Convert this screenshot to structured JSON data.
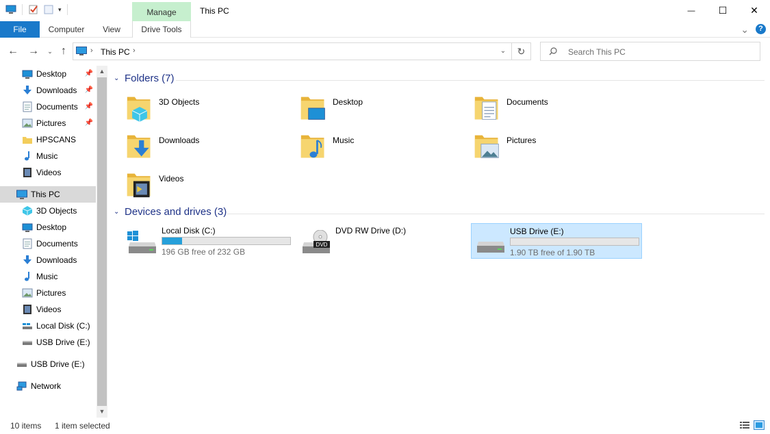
{
  "window": {
    "title": "This PC",
    "manage_tab": "Manage",
    "minimize_glyph": "—",
    "maximize_glyph": "☐",
    "close_glyph": "✕"
  },
  "ribbon": {
    "tabs": [
      "File",
      "Computer",
      "View",
      "Drive Tools"
    ],
    "collapse_glyph": "⌄",
    "help_glyph": "?"
  },
  "address": {
    "path_label": "This PC",
    "search_placeholder": "Search This PC"
  },
  "nav_pane": {
    "quick_access": [
      {
        "label": "Desktop",
        "icon": "desktop-icon",
        "pinned": true
      },
      {
        "label": "Downloads",
        "icon": "downloads-icon",
        "pinned": true
      },
      {
        "label": "Documents",
        "icon": "documents-icon",
        "pinned": true
      },
      {
        "label": "Pictures",
        "icon": "pictures-icon",
        "pinned": true
      },
      {
        "label": "HPSCANS",
        "icon": "folder-icon",
        "pinned": false
      },
      {
        "label": "Music",
        "icon": "music-icon",
        "pinned": false
      },
      {
        "label": "Videos",
        "icon": "videos-icon",
        "pinned": false
      }
    ],
    "this_pc": {
      "label": "This PC",
      "icon": "this-pc-icon",
      "selected": true
    },
    "this_pc_children": [
      {
        "label": "3D Objects",
        "icon": "3d-objects-icon"
      },
      {
        "label": "Desktop",
        "icon": "desktop-icon"
      },
      {
        "label": "Documents",
        "icon": "documents-icon"
      },
      {
        "label": "Downloads",
        "icon": "downloads-icon"
      },
      {
        "label": "Music",
        "icon": "music-icon"
      },
      {
        "label": "Pictures",
        "icon": "pictures-icon"
      },
      {
        "label": "Videos",
        "icon": "videos-icon"
      },
      {
        "label": "Local Disk (C:)",
        "icon": "local-disk-icon"
      },
      {
        "label": "USB Drive (E:)",
        "icon": "usb-drive-icon"
      }
    ],
    "usb_root": {
      "label": "USB Drive (E:)",
      "icon": "usb-drive-icon"
    },
    "network": {
      "label": "Network",
      "icon": "network-icon"
    }
  },
  "content": {
    "folders_header": "Folders (7)",
    "folders": [
      {
        "label": "3D Objects",
        "icon": "3d-objects-icon"
      },
      {
        "label": "Desktop",
        "icon": "desktop-icon"
      },
      {
        "label": "Documents",
        "icon": "documents-icon"
      },
      {
        "label": "Downloads",
        "icon": "downloads-icon"
      },
      {
        "label": "Music",
        "icon": "music-icon"
      },
      {
        "label": "Pictures",
        "icon": "pictures-icon"
      },
      {
        "label": "Videos",
        "icon": "videos-icon"
      }
    ],
    "drives_header": "Devices and drives (3)",
    "drives": [
      {
        "name": "Local Disk (C:)",
        "free_text": "196 GB free of 232 GB",
        "used_fraction": 0.155,
        "icon": "local-disk-icon",
        "selected": false,
        "has_bar": true
      },
      {
        "name": "DVD RW Drive (D:)",
        "free_text": "",
        "used_fraction": 0,
        "icon": "dvd-drive-icon",
        "selected": false,
        "has_bar": false
      },
      {
        "name": "USB Drive (E:)",
        "free_text": "1.90 TB free of 1.90 TB",
        "used_fraction": 0.0,
        "icon": "usb-drive-icon",
        "selected": true,
        "has_bar": true
      }
    ],
    "dvd_badge": "DVD"
  },
  "status": {
    "item_count": "10 items",
    "selection": "1 item selected"
  },
  "colors": {
    "accent": "#1979ca",
    "manage_tab": "#c6efce",
    "selection_bg": "#cce8ff",
    "drive_fill": "#26a0da",
    "group_header": "#1e3287"
  }
}
